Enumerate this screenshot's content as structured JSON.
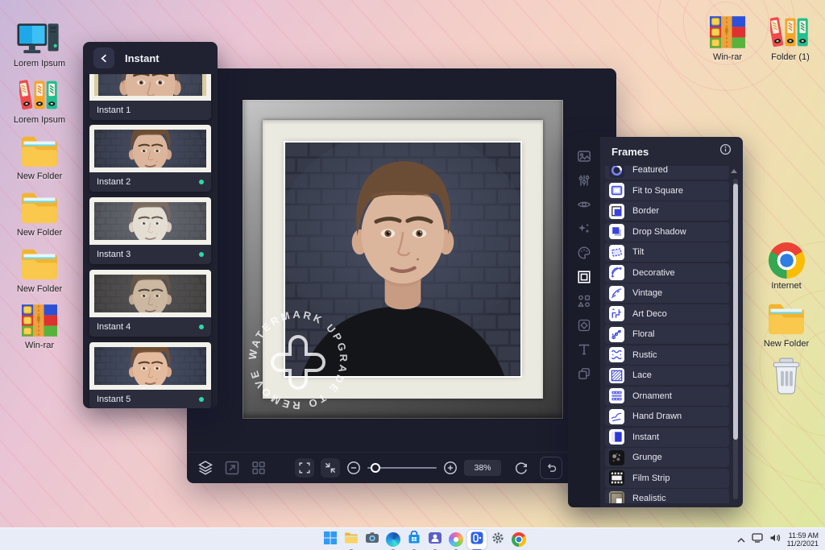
{
  "desktop": {
    "left_icons": [
      {
        "label": "Lorem Ipsum",
        "icon": "computer"
      },
      {
        "label": "Lorem Ipsum",
        "icon": "binders"
      },
      {
        "label": "New Folder",
        "icon": "folder"
      },
      {
        "label": "New Folder",
        "icon": "folder"
      },
      {
        "label": "New Folder",
        "icon": "folder"
      },
      {
        "label": "Win-rar",
        "icon": "winrar"
      }
    ],
    "top_right_icons": [
      {
        "label": "Win-rar",
        "icon": "winrar"
      },
      {
        "label": "Folder (1)",
        "icon": "binders"
      }
    ],
    "right_icons": [
      {
        "label": "Internet",
        "icon": "chrome"
      },
      {
        "label": "New Folder",
        "icon": "folder"
      },
      {
        "label": "",
        "icon": "trash"
      }
    ]
  },
  "editor": {
    "instant_panel": {
      "title": "Instant",
      "back_icon": "arrow-left",
      "items": [
        {
          "label": "Instant 1",
          "selected": false
        },
        {
          "label": "Instant 2",
          "selected": true
        },
        {
          "label": "Instant 3",
          "selected": true
        },
        {
          "label": "Instant 4",
          "selected": true
        },
        {
          "label": "Instant 5",
          "selected": true
        }
      ]
    },
    "tool_sidebar": [
      "image",
      "adjust",
      "effects-eye",
      "sparkles",
      "palette",
      "frame",
      "elements",
      "pattern",
      "text",
      "overlap"
    ],
    "active_tool": "frame",
    "frames_panel": {
      "title": "Frames",
      "info_icon": "info",
      "items": [
        {
          "label": "Featured",
          "icon": "featured"
        },
        {
          "label": "Fit to Square",
          "icon": "fit-square"
        },
        {
          "label": "Border",
          "icon": "border"
        },
        {
          "label": "Drop Shadow",
          "icon": "drop-shadow"
        },
        {
          "label": "Tilt",
          "icon": "tilt"
        },
        {
          "label": "Decorative",
          "icon": "decorative"
        },
        {
          "label": "Vintage",
          "icon": "vintage"
        },
        {
          "label": "Art Deco",
          "icon": "art-deco"
        },
        {
          "label": "Floral",
          "icon": "floral"
        },
        {
          "label": "Rustic",
          "icon": "rustic"
        },
        {
          "label": "Lace",
          "icon": "lace"
        },
        {
          "label": "Ornament",
          "icon": "ornament"
        },
        {
          "label": "Hand Drawn",
          "icon": "hand-drawn"
        },
        {
          "label": "Instant",
          "icon": "instant"
        },
        {
          "label": "Grunge",
          "icon": "grunge"
        },
        {
          "label": "Film Strip",
          "icon": "film-strip"
        },
        {
          "label": "Realistic",
          "icon": "realistic"
        }
      ]
    },
    "toolbar": {
      "zoom_value": "38%"
    },
    "watermark": {
      "text": "WATERMARK UPGRADE TO REMOVE"
    }
  },
  "taskbar": {
    "apps": [
      {
        "name": "start",
        "running": false,
        "active": false
      },
      {
        "name": "explorer",
        "running": true,
        "active": false
      },
      {
        "name": "camera",
        "running": false,
        "active": false
      },
      {
        "name": "edge",
        "running": true,
        "active": false
      },
      {
        "name": "store",
        "running": true,
        "active": false
      },
      {
        "name": "teams",
        "running": true,
        "active": false
      },
      {
        "name": "paint",
        "running": true,
        "active": false
      },
      {
        "name": "photo-app",
        "running": true,
        "active": true
      },
      {
        "name": "settings",
        "running": false,
        "active": false
      },
      {
        "name": "chrome",
        "running": false,
        "active": false
      }
    ],
    "tray": {
      "time": "11:59 AM",
      "date": "11/2/2021",
      "icons": [
        "chevron-up",
        "display",
        "speaker"
      ]
    }
  },
  "colors": {
    "selected_dot": "#2fd9a5",
    "frames_accent": "#4750e0",
    "window_bg": "#1b1d2d",
    "taskbar_bg": "#e8ecf6"
  }
}
